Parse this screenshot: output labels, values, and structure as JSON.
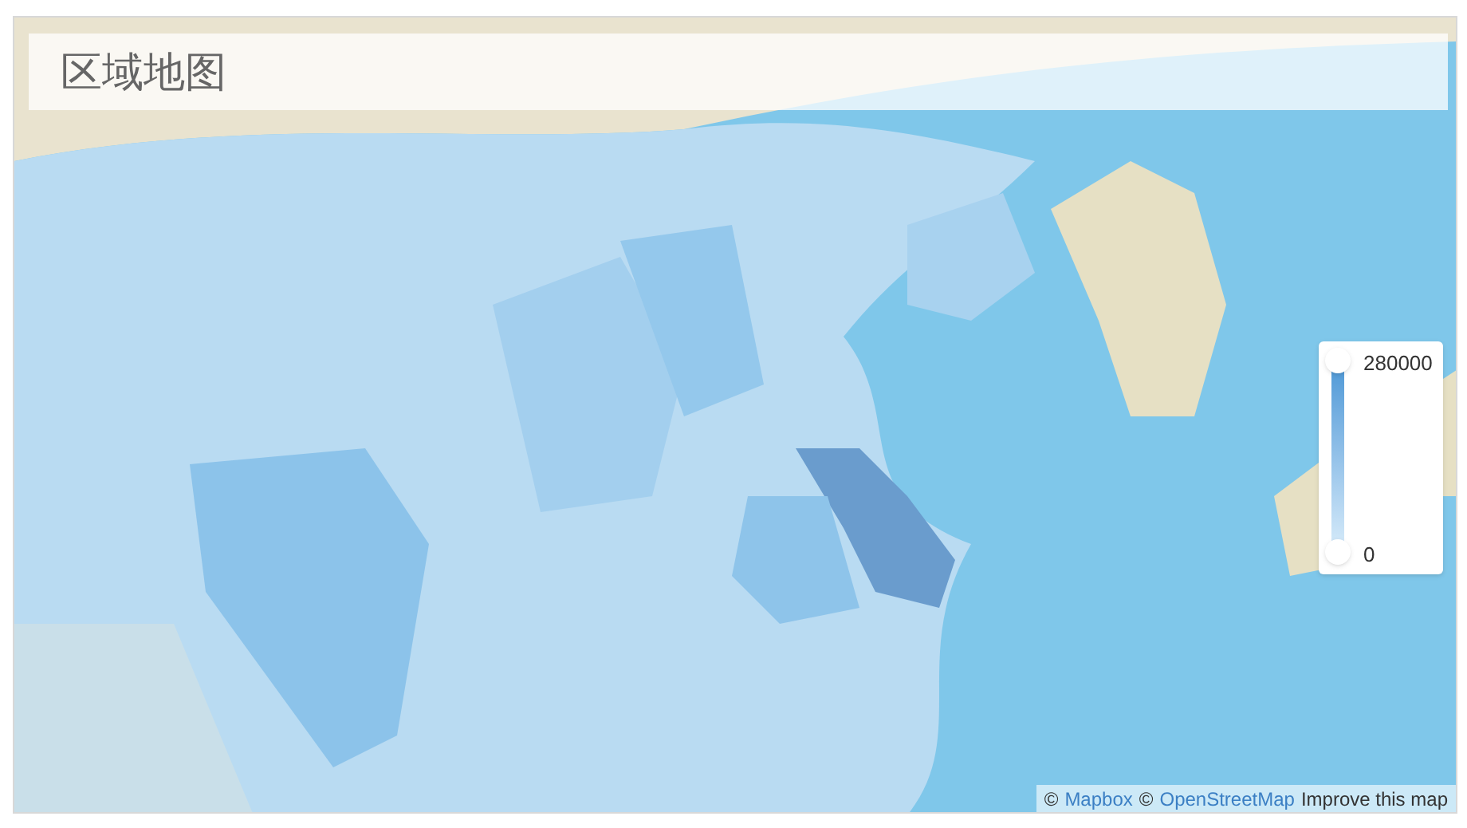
{
  "title": "区域地图",
  "legend": {
    "max_label": "280000",
    "min_label": "0"
  },
  "attribution": [
    {
      "kind": "plain",
      "text": "©"
    },
    {
      "kind": "link",
      "text": "Mapbox"
    },
    {
      "kind": "plain",
      "text": "©"
    },
    {
      "kind": "link",
      "text": "OpenStreetMap"
    },
    {
      "kind": "dark-link",
      "text": "Improve this map"
    }
  ]
}
